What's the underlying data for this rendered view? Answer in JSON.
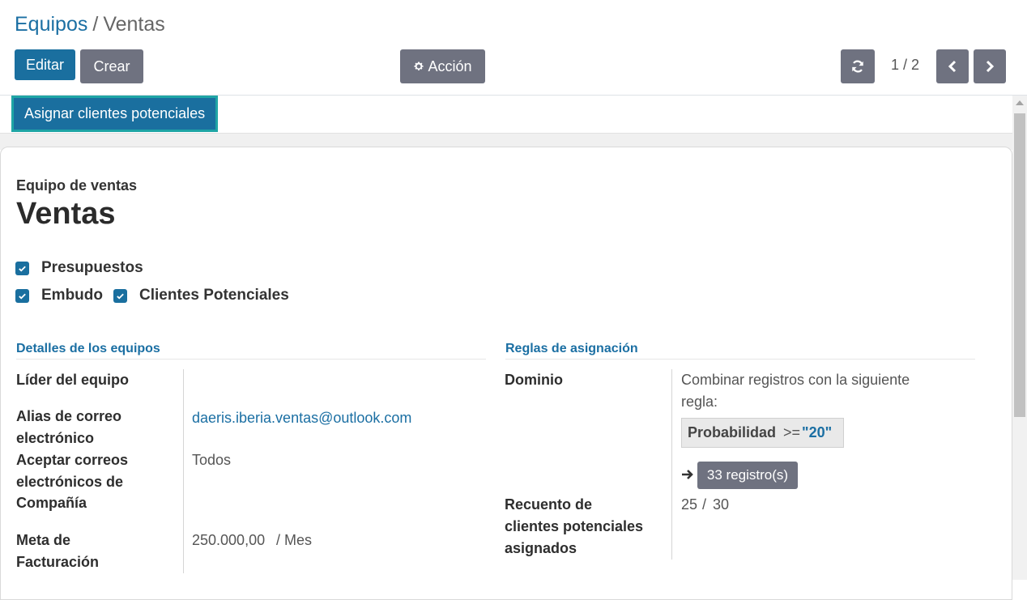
{
  "breadcrumb": {
    "parent": "Equipos",
    "separator": "/",
    "current": "Ventas"
  },
  "toolbar": {
    "edit_label": "Editar",
    "create_label": "Crear",
    "action_label": "Acción"
  },
  "pager": {
    "value": "1 / 2"
  },
  "statusbar": {
    "assign_label": "Asignar clientes potenciales"
  },
  "form": {
    "title_label": "Equipo de ventas",
    "title": "Ventas",
    "checkboxes": [
      {
        "label": "Presupuestos",
        "checked": true
      },
      {
        "label": "Embudo",
        "checked": true
      },
      {
        "label": "Clientes Potenciales",
        "checked": true
      }
    ],
    "team_details": {
      "section_title": "Detalles de los equipos",
      "leader_label": "Líder del equipo",
      "leader_value": "",
      "alias_label_1": "Alias de correo",
      "alias_label_2": "electrónico",
      "alias_value": "daeris.iberia.ventas@outlook.com",
      "accept_label_1": "Aceptar correos",
      "accept_label_2": "electrónicos de",
      "accept_label_3": "Compañía",
      "accept_value": "Todos",
      "goal_label_1": "Meta de",
      "goal_label_2": "Facturación",
      "goal_value": "250.000,00",
      "goal_unit": "/ Mes"
    },
    "assignment_rules": {
      "section_title": "Reglas de asignación",
      "domain_label": "Dominio",
      "domain_text_1": "Combinar registros con la siguiente",
      "domain_text_2": "regla:",
      "rule_field": "Probabilidad",
      "rule_operator": ">=",
      "rule_value": "\"20\"",
      "records_button": "33 registro(s)",
      "count_label_1": "Recuento de",
      "count_label_2": "clientes potenciales",
      "count_label_3": "asignados",
      "count_value": "25",
      "count_separator": "/",
      "count_max": "30"
    }
  },
  "colors": {
    "primary": "#1a6f9f",
    "secondary": "#6f7280",
    "link": "#1b6fa3",
    "highlight_border": "#1fa5a5"
  },
  "icons": {
    "action": "gear-icon",
    "refresh": "refresh-icon",
    "prev": "chevron-left-icon",
    "next": "chevron-right-icon",
    "checkbox": "check-icon",
    "records_arrow": "arrow-right-icon"
  }
}
